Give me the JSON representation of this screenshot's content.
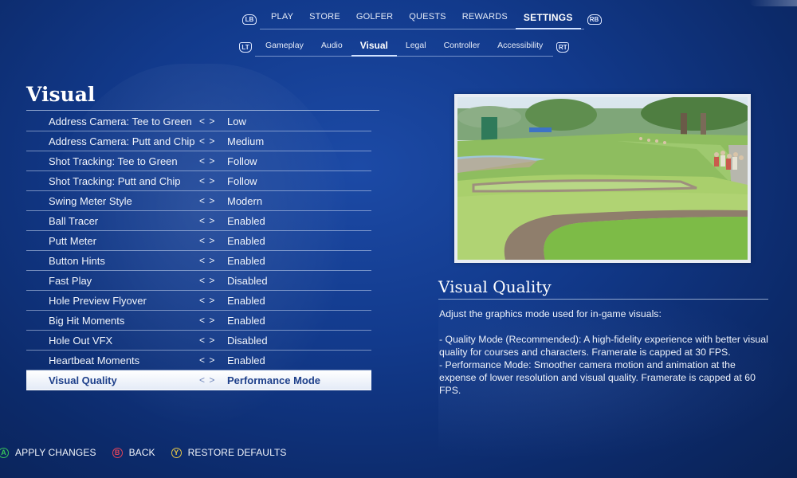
{
  "nav": {
    "left_bumper": "LB",
    "right_bumper": "RB",
    "tabs": [
      {
        "label": "PLAY",
        "active": false
      },
      {
        "label": "STORE",
        "active": false
      },
      {
        "label": "GOLFER",
        "active": false
      },
      {
        "label": "QUESTS",
        "active": false
      },
      {
        "label": "REWARDS",
        "active": false
      },
      {
        "label": "SETTINGS",
        "active": true
      }
    ]
  },
  "subnav": {
    "left_trigger": "LT",
    "right_trigger": "RT",
    "tabs": [
      {
        "label": "Gameplay",
        "active": false
      },
      {
        "label": "Audio",
        "active": false
      },
      {
        "label": "Visual",
        "active": true
      },
      {
        "label": "Legal",
        "active": false
      },
      {
        "label": "Controller",
        "active": false
      },
      {
        "label": "Accessibility",
        "active": false
      }
    ]
  },
  "section": {
    "title": "Visual",
    "arrows": "< >",
    "settings": [
      {
        "label": "Address Camera: Tee to Green",
        "value": "Low"
      },
      {
        "label": "Address Camera: Putt and Chip",
        "value": "Medium"
      },
      {
        "label": "Shot Tracking: Tee to Green",
        "value": "Follow"
      },
      {
        "label": "Shot Tracking: Putt and Chip",
        "value": "Follow"
      },
      {
        "label": "Swing Meter Style",
        "value": "Modern"
      },
      {
        "label": "Ball Tracer",
        "value": "Enabled"
      },
      {
        "label": "Putt Meter",
        "value": "Enabled"
      },
      {
        "label": "Button Hints",
        "value": "Enabled"
      },
      {
        "label": "Fast Play",
        "value": "Disabled"
      },
      {
        "label": "Hole Preview Flyover",
        "value": "Enabled"
      },
      {
        "label": "Big Hit Moments",
        "value": "Enabled"
      },
      {
        "label": "Hole Out VFX",
        "value": "Disabled"
      },
      {
        "label": "Heartbeat Moments",
        "value": "Enabled"
      },
      {
        "label": "Visual Quality",
        "value": "Performance Mode",
        "selected": true
      }
    ]
  },
  "description": {
    "title": "Visual Quality",
    "body": "Adjust the graphics mode used for in-game visuals:\n\n- Quality Mode (Recommended): A high-fidelity experience with better visual quality for courses and characters. Framerate is capped at 30 FPS.\n- Performance Mode: Smoother camera motion and animation at the expense of lower resolution and visual quality. Framerate is capped at 60 FPS."
  },
  "footer": {
    "apply": {
      "button": "A",
      "label": "APPLY CHANGES",
      "color": "#37c45a"
    },
    "back": {
      "button": "B",
      "label": "BACK",
      "color": "#e0445a"
    },
    "restore": {
      "button": "Y",
      "label": "RESTORE DEFAULTS",
      "color": "#e3c64a"
    }
  }
}
